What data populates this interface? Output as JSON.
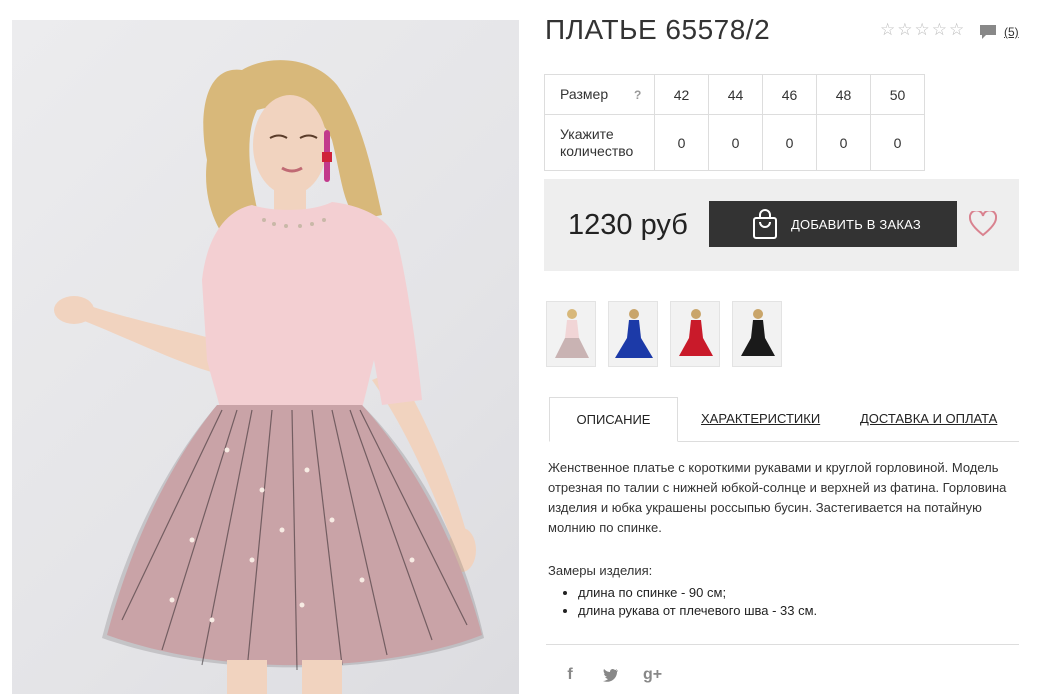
{
  "product": {
    "title": "ПЛАТЬЕ 65578/2",
    "rating_stars": 5,
    "rating_filled": 0,
    "comments_count": "(5)"
  },
  "size_table": {
    "size_label": "Размер",
    "help_symbol": "?",
    "quantity_label": "Укажите количество",
    "sizes": [
      "42",
      "44",
      "46",
      "48",
      "50"
    ],
    "quantities": [
      "0",
      "0",
      "0",
      "0",
      "0"
    ]
  },
  "purchase": {
    "price": "1230 руб",
    "add_button": "ДОБАВИТЬ В ЗАКАЗ"
  },
  "thumbnails": [
    {
      "color": "pink",
      "dress_hex": "#f1d5d6"
    },
    {
      "color": "blue",
      "dress_hex": "#1c3aa8"
    },
    {
      "color": "red",
      "dress_hex": "#c91a2a"
    },
    {
      "color": "black",
      "dress_hex": "#1a1a1a"
    }
  ],
  "tabs": [
    {
      "label": "ОПИСАНИЕ",
      "active": true
    },
    {
      "label": "ХАРАКТЕРИСТИКИ",
      "active": false
    },
    {
      "label": "ДОСТАВКА И ОПЛАТА",
      "active": false
    }
  ],
  "description": {
    "text": "Женственное платье с короткими рукавами и круглой горловиной. Модель отрезная по талии с нижней юбкой-солнце и верхней из фатина. Горловина изделия и юбка украшены россыпью бусин. Застегивается на потайную молнию по спинке.",
    "measures_title": "Замеры изделия:",
    "measures": [
      "длина по спинке - 90 см;",
      "длина рукава от плечевого шва - 33 см."
    ]
  },
  "social": [
    "f",
    "twitter-icon",
    "g+"
  ],
  "colors": {
    "button_bg": "#333333",
    "heart": "#d9828f",
    "price_box_bg": "#eeeeee"
  }
}
